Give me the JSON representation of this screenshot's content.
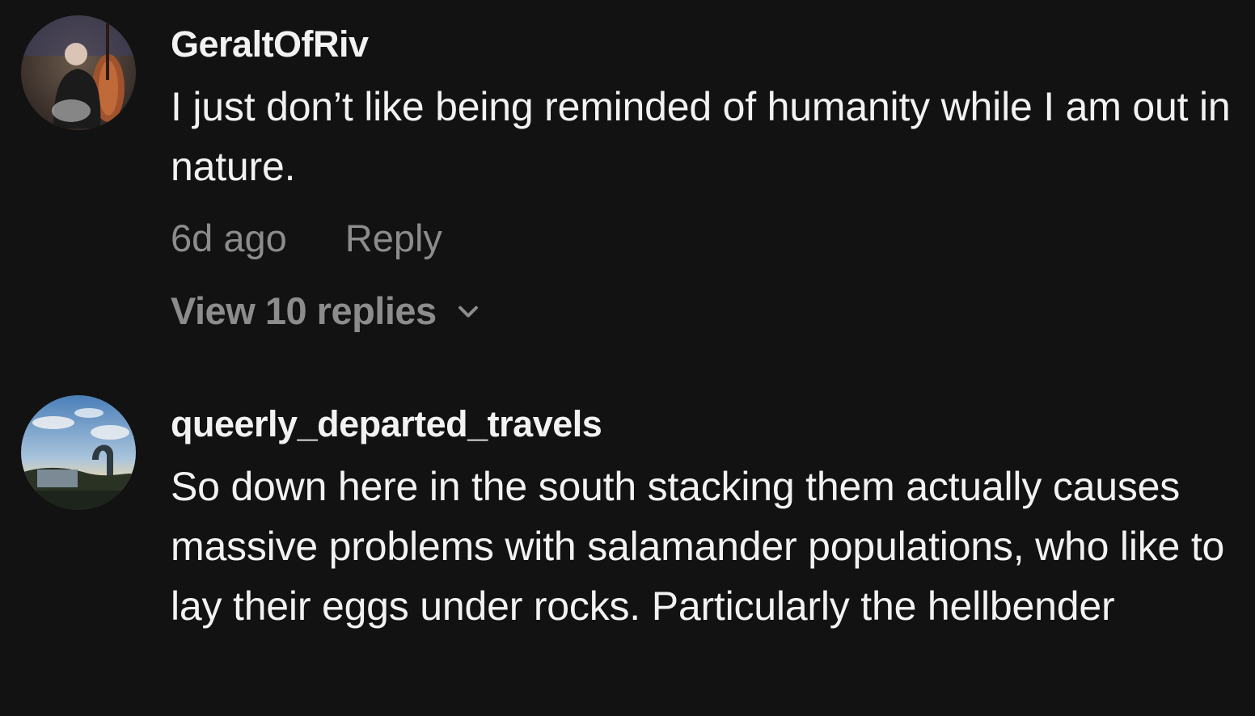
{
  "comments": [
    {
      "username": "GeraltOfRiv",
      "text": "I just don’t like being reminded of humanity while I am out in nature.",
      "time": "6d ago",
      "reply_label": "Reply",
      "view_replies_label": "View 10 replies",
      "avatar_icon": "musician-with-double-bass-avatar"
    },
    {
      "username": "queerly_departed_travels",
      "text": "So down here in the south stacking them actually causes massive problems with salamander populations, who like to lay their eggs under rocks. Particularly the hellbender",
      "avatar_icon": "sky-landscape-sculpture-avatar"
    }
  ],
  "colors": {
    "background": "#121212",
    "primary_text": "#f2f2f2",
    "secondary_text": "#8c8c8c"
  }
}
